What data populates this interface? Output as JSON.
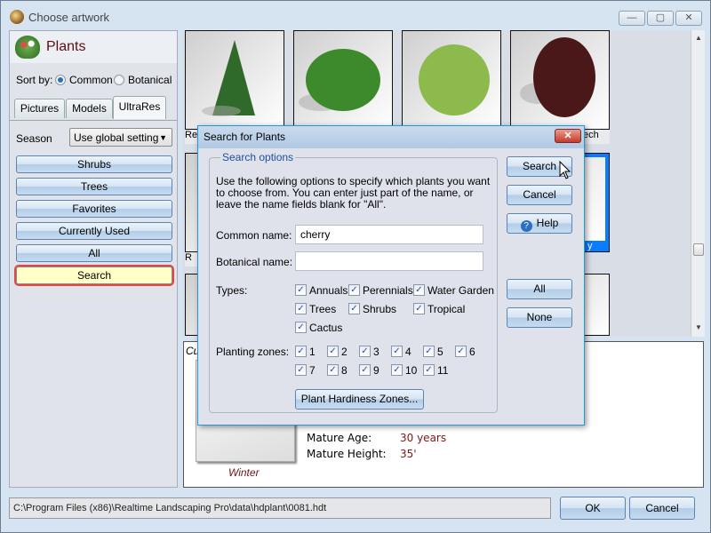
{
  "window": {
    "title": "Choose artwork",
    "controls": {
      "minimize": "—",
      "maximize": "▢",
      "close": "✕"
    }
  },
  "left_panel": {
    "title": "Plants",
    "sort_by_label": "Sort by:",
    "sort_options": [
      {
        "label": "Common",
        "selected": true
      },
      {
        "label": "Botanical",
        "selected": false
      }
    ],
    "tabs": [
      {
        "label": "Pictures",
        "active": false
      },
      {
        "label": "Models",
        "active": false
      },
      {
        "label": "UltraRes",
        "active": true
      }
    ],
    "season_label": "Season",
    "season_value": "Use global setting",
    "categories": [
      "Shrubs",
      "Trees",
      "Favorites",
      "Currently Used",
      "All",
      "Search"
    ],
    "selected_category": "Search"
  },
  "gallery": {
    "partial_labels": [
      "Re",
      "ech",
      "R",
      "y"
    ]
  },
  "info": {
    "caption_partial": "Cu",
    "image_caption": "Winter",
    "properties": [
      {
        "label": "Mature Age:",
        "value": "30 years"
      },
      {
        "label": "Mature Height:",
        "value": "35'"
      }
    ]
  },
  "footer": {
    "path": "C:\\Program Files (x86)\\Realtime Landscaping Pro\\data\\hdplant\\0081.hdt",
    "ok_label": "OK",
    "cancel_label": "Cancel"
  },
  "dialog": {
    "title": "Search for Plants",
    "close_glyph": "✕",
    "group_title": "Search options",
    "description": "Use the following options to specify which plants you want to choose from. You can enter just part of the name, or leave the name fields blank for \"All\".",
    "common_name_label": "Common name:",
    "common_name_value": "cherry",
    "botanical_name_label": "Botanical name:",
    "botanical_name_value": "",
    "types_label": "Types:",
    "types": [
      {
        "label": "Annuals",
        "checked": true
      },
      {
        "label": "Perennials",
        "checked": true
      },
      {
        "label": "Water Garden",
        "checked": true
      },
      {
        "label": "Trees",
        "checked": true
      },
      {
        "label": "Shrubs",
        "checked": true
      },
      {
        "label": "Tropical",
        "checked": true
      },
      {
        "label": "Cactus",
        "checked": true
      }
    ],
    "zones_label": "Planting zones:",
    "zones": [
      "1",
      "2",
      "3",
      "4",
      "5",
      "6",
      "7",
      "8",
      "9",
      "10",
      "11"
    ],
    "zones_checked": true,
    "hardiness_button": "Plant Hardiness Zones...",
    "buttons": {
      "search": "Search",
      "cancel": "Cancel",
      "help": "Help",
      "all": "All",
      "none": "None"
    },
    "check_glyph": "✓",
    "help_glyph": "?"
  }
}
